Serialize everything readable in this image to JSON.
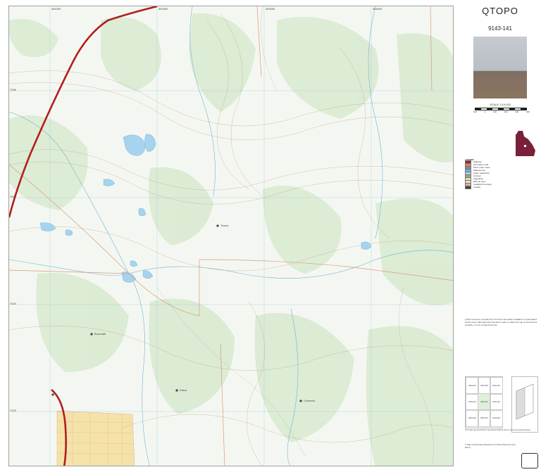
{
  "map": {
    "title": "QTOPO",
    "sheet_number": "9143-141",
    "scale_text": "SCALE 1:10,000",
    "scale_ticks": [
      "100",
      "0",
      "100",
      "200",
      "300",
      "400"
    ],
    "grid_labels_top": [
      "361000",
      "362000",
      "363000",
      "364000",
      "365000"
    ],
    "grid_labels_left": [
      "7026",
      "7025",
      "7024",
      "7023",
      "7022"
    ],
    "legend_heading": "LEGEND",
    "legend_items": [
      {
        "label": "Highway",
        "color": "#b21e1e"
      },
      {
        "label": "Secondary road",
        "color": "#c88a64"
      },
      {
        "label": "Minor road / track",
        "color": "#888888"
      },
      {
        "label": "Watercourse",
        "color": "#6fb3d9"
      },
      {
        "label": "Lake / waterbody",
        "color": "#a6d3ee"
      },
      {
        "label": "Contour",
        "color": "#b89a7a"
      },
      {
        "label": "Vegetation",
        "color": "#cfe6c4"
      },
      {
        "label": "Built-up area",
        "color": "#f4e2a8"
      },
      {
        "label": "Cadastral boundary",
        "color": "#e3a8a8"
      },
      {
        "label": "Locality",
        "color": "#444444"
      }
    ],
    "disclaimer": "QTopo has been compiled from the best information available to Queensland Government. Although effort has been made to make the map as accurate as possible, it is not a legal document.",
    "footer": "This map may be printed or reproduced without fee for non-commercial purposes.",
    "copyright": "© State of Queensland (Department of Natural Resources and Mines)",
    "index_cells": [
      "9044-231",
      "9144-234",
      "9144-143",
      "9143-224",
      "9143-141",
      "9143-142",
      "9043-434",
      "9143-314",
      "9143-323"
    ],
    "place_labels": [
      "Towns",
      "Boondah",
      "Kalva",
      "Coolaroo"
    ]
  }
}
